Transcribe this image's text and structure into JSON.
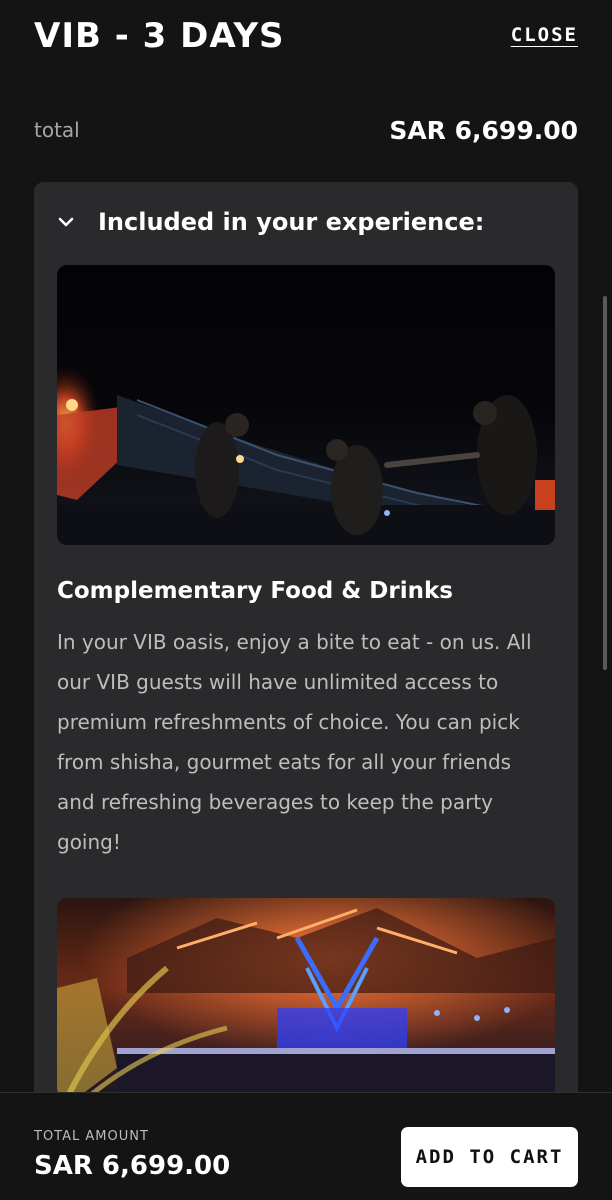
{
  "header": {
    "title": "VIB - 3 DAYS",
    "close_label": "CLOSE"
  },
  "summary": {
    "total_label": "total",
    "total_value": "SAR 6,699.00"
  },
  "experience": {
    "section_title": "Included in your experience:",
    "items": [
      {
        "title": "Complementary Food & Drinks",
        "description": "In your VIB oasis, enjoy a bite to eat -  on us. All our VIB guests will have unlimited access to premium refreshments of choice. You can pick from shisha, gourmet eats for all your friends and refreshing beverages to keep the party going!"
      }
    ]
  },
  "footer": {
    "total_amount_label": "TOTAL AMOUNT",
    "total_amount_value": "SAR 6,699.00",
    "add_to_cart_label": "ADD TO CART"
  },
  "icons": {
    "section_toggle": "chevron-down-icon"
  }
}
